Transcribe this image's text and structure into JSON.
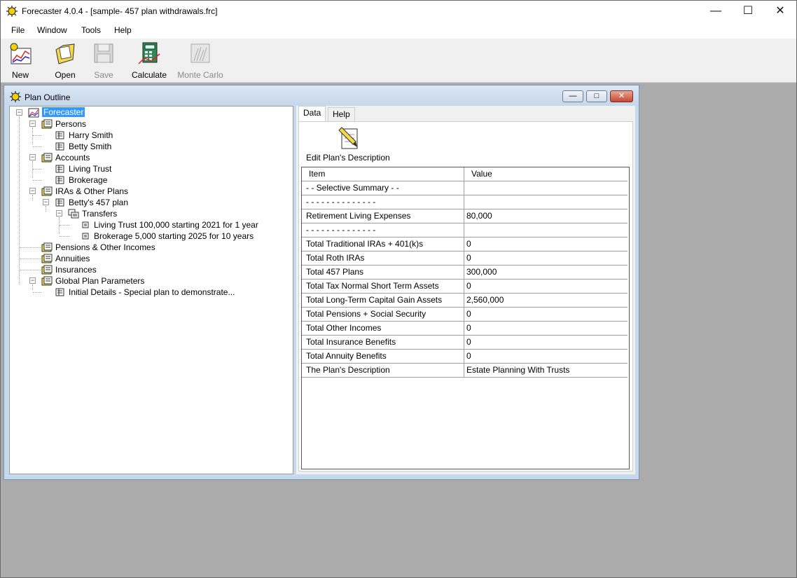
{
  "window": {
    "title": "Forecaster 4.0.4 - [sample- 457 plan withdrawals.frc]"
  },
  "menu": [
    "File",
    "Window",
    "Tools",
    "Help"
  ],
  "toolbar": {
    "new": "New",
    "open": "Open",
    "save": "Save",
    "calculate": "Calculate",
    "monte_carlo": "Monte Carlo"
  },
  "child": {
    "title": "Plan Outline"
  },
  "tree": {
    "root": "Forecaster",
    "persons": "Persons",
    "harry": "Harry Smith",
    "betty": "Betty Smith",
    "accounts": "Accounts",
    "living_trust": "Living Trust",
    "brokerage": "Brokerage",
    "iras": "IRAs & Other Plans",
    "bettys_plan": "Betty's 457 plan",
    "transfers": "Transfers",
    "transfer1": "Living Trust 100,000 starting 2021 for 1 year",
    "transfer2": "Brokerage 5,000 starting 2025 for 10 years",
    "pensions": "Pensions & Other Incomes",
    "annuities": "Annuities",
    "insurances": "Insurances",
    "global": "Global Plan Parameters",
    "initial": "Initial Details - Special plan to demonstrate..."
  },
  "tabs": {
    "data": "Data",
    "help": "Help"
  },
  "edit_description": "Edit Plan's Description",
  "grid": {
    "headers": {
      "item": "Item",
      "value": "Value"
    },
    "rows": [
      {
        "item": "- - Selective Summary - -",
        "value": ""
      },
      {
        "item": "- - - - - - - - - - - - - -",
        "value": ""
      },
      {
        "item": "Retirement Living Expenses",
        "value": "80,000"
      },
      {
        "item": "- - - - - - - - - - - - - -",
        "value": ""
      },
      {
        "item": "Total Traditional IRAs + 401(k)s",
        "value": "0"
      },
      {
        "item": "Total Roth IRAs",
        "value": "0"
      },
      {
        "item": "Total 457 Plans",
        "value": "300,000"
      },
      {
        "item": "Total Tax Normal Short Term Assets",
        "value": "0"
      },
      {
        "item": "Total Long-Term Capital Gain Assets",
        "value": "2,560,000"
      },
      {
        "item": "Total Pensions + Social Security",
        "value": "0"
      },
      {
        "item": "Total Other Incomes",
        "value": "0"
      },
      {
        "item": "Total Insurance Benefits",
        "value": "0"
      },
      {
        "item": "Total Annuity Benefits",
        "value": "0"
      },
      {
        "item": "The Plan's Description",
        "value": "Estate Planning With Trusts"
      }
    ]
  }
}
